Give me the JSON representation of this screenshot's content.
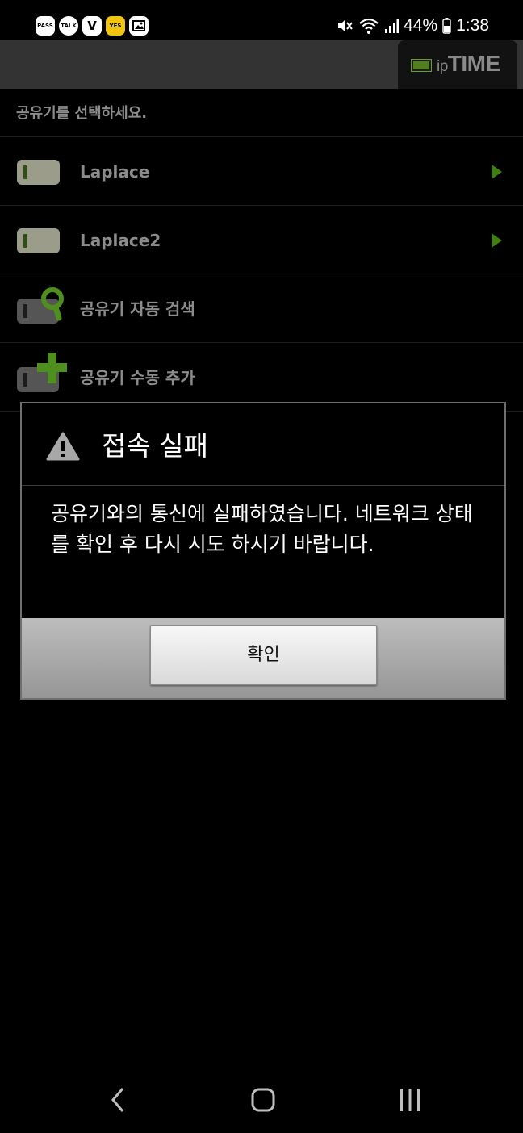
{
  "status_bar": {
    "apps": [
      "PASS",
      "TALK",
      "V",
      "YES",
      "gallery"
    ],
    "battery": "44%",
    "time": "1:38"
  },
  "header": {
    "logo_ip": "ip",
    "logo_time": "TIME"
  },
  "list": {
    "header": "공유기를 선택하세요.",
    "items": [
      {
        "label": "Laplace",
        "icon": "router-icon"
      },
      {
        "label": "Laplace2",
        "icon": "router-icon"
      },
      {
        "label": "공유기 자동 검색",
        "icon": "router-search-icon"
      },
      {
        "label": "공유기 수동 추가",
        "icon": "router-add-icon"
      }
    ]
  },
  "dialog": {
    "title": "접속 실패",
    "message": "공유기와의 통신에 실패하였습니다. 네트워크 상태를 확인 후 다시 시도 하시기 바랍니다.",
    "ok_label": "확인"
  },
  "colors": {
    "accent_green": "#3f7f13",
    "header_bg": "#333333",
    "dialog_footer": "#aaaaaa"
  }
}
